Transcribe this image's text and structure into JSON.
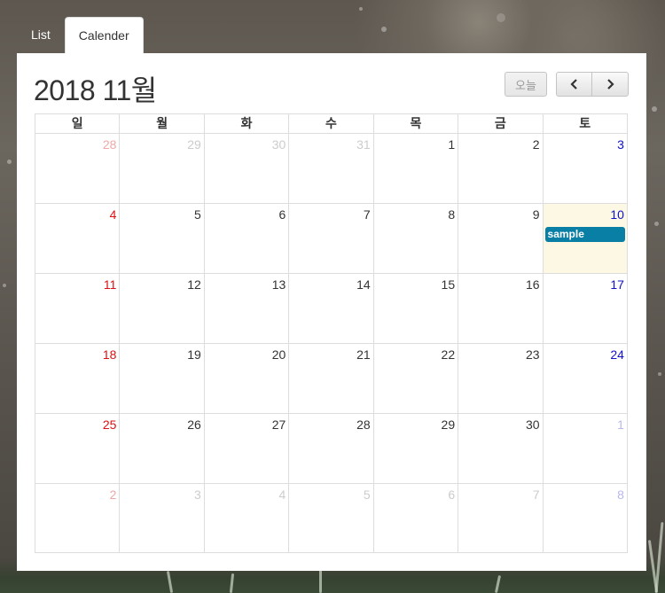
{
  "tabs": [
    {
      "label": "List",
      "active": false
    },
    {
      "label": "Calender",
      "active": true
    }
  ],
  "calendar": {
    "title": "2018 11월",
    "today_label": "오늘",
    "prev_icon": "chevron-left-icon",
    "next_icon": "chevron-right-icon",
    "weekdays": [
      "일",
      "월",
      "화",
      "수",
      "목",
      "금",
      "토"
    ],
    "weeks": [
      [
        {
          "d": "28",
          "other": true
        },
        {
          "d": "29",
          "other": true
        },
        {
          "d": "30",
          "other": true
        },
        {
          "d": "31",
          "other": true
        },
        {
          "d": "1"
        },
        {
          "d": "2"
        },
        {
          "d": "3"
        }
      ],
      [
        {
          "d": "4"
        },
        {
          "d": "5"
        },
        {
          "d": "6"
        },
        {
          "d": "7"
        },
        {
          "d": "8"
        },
        {
          "d": "9"
        },
        {
          "d": "10",
          "today": true,
          "event": "sample"
        }
      ],
      [
        {
          "d": "11"
        },
        {
          "d": "12"
        },
        {
          "d": "13"
        },
        {
          "d": "14"
        },
        {
          "d": "15"
        },
        {
          "d": "16"
        },
        {
          "d": "17"
        }
      ],
      [
        {
          "d": "18"
        },
        {
          "d": "19"
        },
        {
          "d": "20"
        },
        {
          "d": "21"
        },
        {
          "d": "22"
        },
        {
          "d": "23"
        },
        {
          "d": "24"
        }
      ],
      [
        {
          "d": "25"
        },
        {
          "d": "26"
        },
        {
          "d": "27"
        },
        {
          "d": "28"
        },
        {
          "d": "29"
        },
        {
          "d": "30"
        },
        {
          "d": "1",
          "other": true
        }
      ],
      [
        {
          "d": "2",
          "other": true
        },
        {
          "d": "3",
          "other": true
        },
        {
          "d": "4",
          "other": true
        },
        {
          "d": "5",
          "other": true
        },
        {
          "d": "6",
          "other": true
        },
        {
          "d": "7",
          "other": true
        },
        {
          "d": "8",
          "other": true
        }
      ]
    ]
  },
  "colors": {
    "sunday": "#dd1111",
    "saturday": "#1111cc",
    "today_bg": "#fcf8e3",
    "event_bg": "#0a7fa6"
  }
}
